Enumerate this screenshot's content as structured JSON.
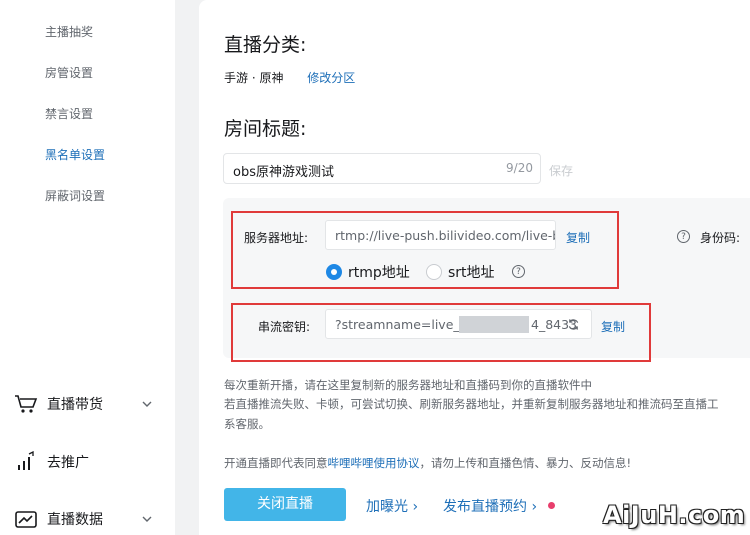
{
  "sidebar": {
    "sub_items": [
      {
        "label": "主播抽奖"
      },
      {
        "label": "房管设置"
      },
      {
        "label": "禁言设置"
      },
      {
        "label": "黑名单设置"
      },
      {
        "label": "屏蔽词设置"
      }
    ],
    "nav": [
      {
        "label": "直播带货",
        "icon": "cart-icon"
      },
      {
        "label": "去推广",
        "icon": "promote-chart-icon"
      },
      {
        "label": "直播数据",
        "icon": "data-chart-icon"
      }
    ]
  },
  "main": {
    "category_title": "直播分类:",
    "category_value": "手游 · 原神",
    "modify_category": "修改分区",
    "room_title_heading": "房间标题:",
    "room_title_value": "obs原神游戏测试",
    "room_title_count": "9/20",
    "save_label": "保存",
    "server_label": "服务器地址:",
    "server_value": "rtmp://live-push.bilivideo.com/live-bvc/",
    "copy_label": "复制",
    "identity_label": "身份码:",
    "radio_rtmp": "rtmp地址",
    "radio_srt": "srt地址",
    "stream_key_label": "串流密钥:",
    "stream_key_value": "?streamname=live_",
    "stream_key_tail": "4_8433",
    "tip_line1": "每次重新开播，请在这里复制新的服务器地址和直播码到你的直播软件中",
    "tip_line2": "若直播推流失败、卡顿，可尝试切换、刷新服务器地址，并重新复制服务器地址和推流码至直播工",
    "tip_line3": "系客服。",
    "agreement_prefix": "开通直播即代表同意",
    "agreement_link": "哔哩哔哩使用协议",
    "agreement_suffix": "，请勿上传和直播色情、暴力、反动信息!",
    "close_live": "关闭直播",
    "boost_label": "加曝光",
    "reserve_label": "发布直播预约"
  },
  "watermark": "AiJuH.com",
  "colors": {
    "accent": "#1e6fb8",
    "primary_button": "#42b5e8",
    "annotation_red": "#e03a3a"
  }
}
